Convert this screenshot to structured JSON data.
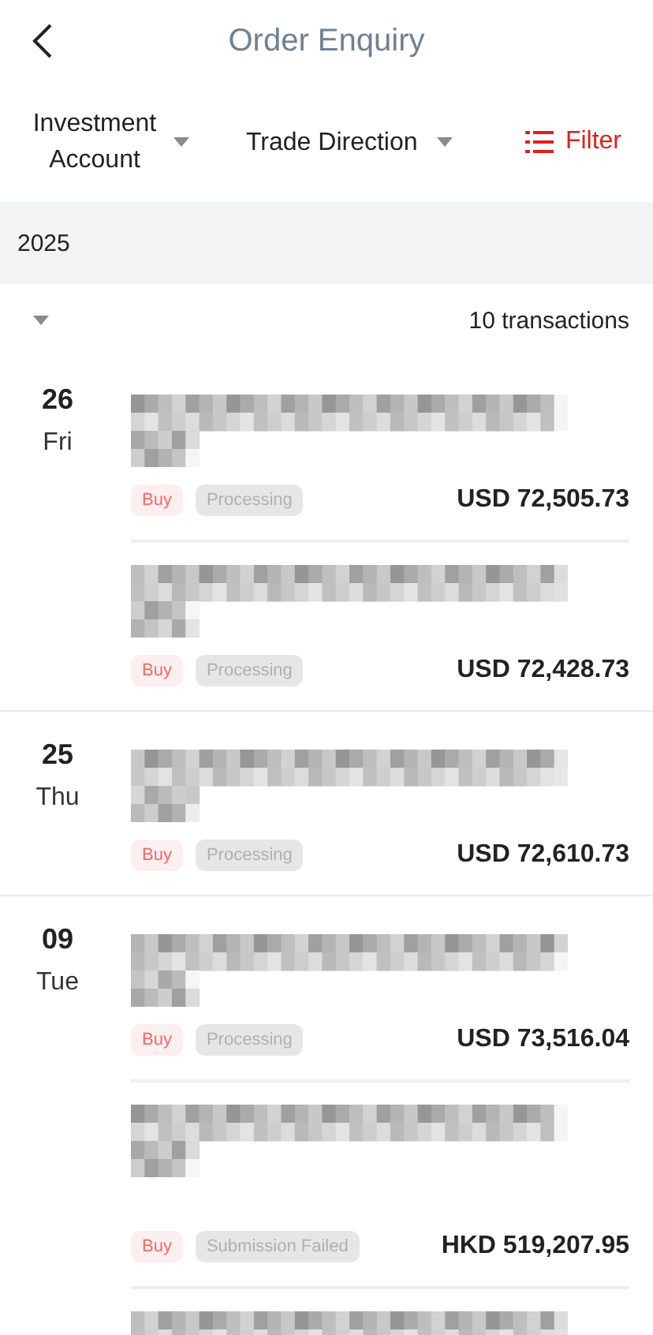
{
  "header": {
    "title": "Order Enquiry"
  },
  "filters": [
    {
      "label": "Investment Account"
    },
    {
      "label": "Trade Direction"
    }
  ],
  "filter_button": {
    "label": "Filter"
  },
  "year": "2025",
  "summary": {
    "count": "10 transactions"
  },
  "groups": [
    {
      "day": "26",
      "weekday": "Fri",
      "orders": [
        {
          "kind": "order",
          "direction": "Buy",
          "status": "Processing",
          "amount": "USD 72,505.73"
        },
        {
          "kind": "order",
          "direction": "Buy",
          "status": "Processing",
          "amount": "USD 72,428.73"
        }
      ]
    },
    {
      "day": "25",
      "weekday": "Thu",
      "orders": [
        {
          "kind": "order",
          "direction": "Buy",
          "status": "Processing",
          "amount": "USD 72,610.73"
        }
      ]
    },
    {
      "day": "09",
      "weekday": "Tue",
      "orders": [
        {
          "kind": "order",
          "direction": "Buy",
          "status": "Processing",
          "amount": "USD 73,516.04"
        },
        {
          "kind": "long",
          "direction": "Buy",
          "status": "Submission Failed",
          "amount": "HKD 519,207.95"
        },
        {
          "kind": "partial"
        }
      ]
    }
  ]
}
